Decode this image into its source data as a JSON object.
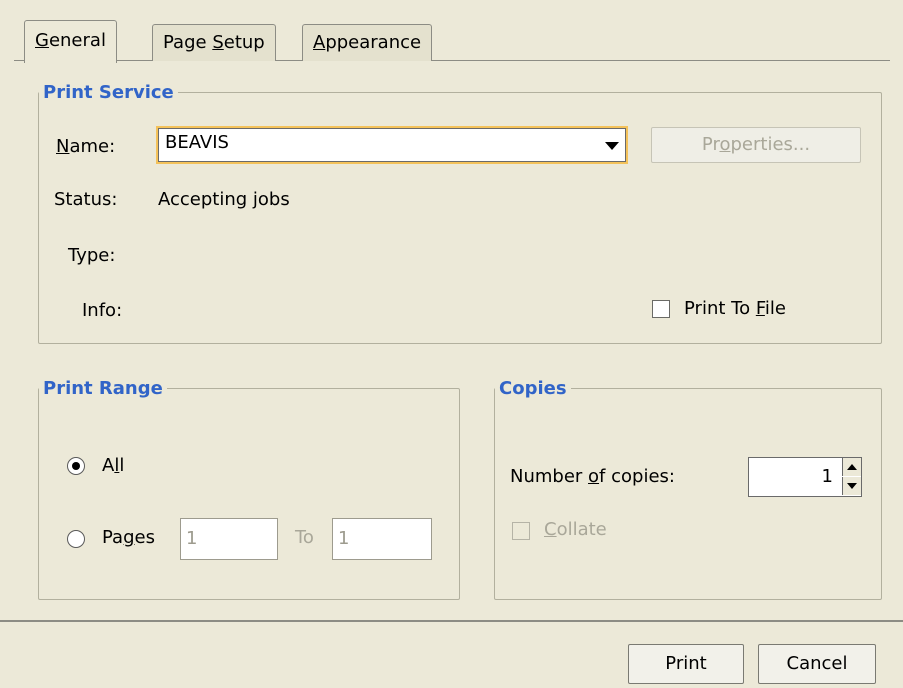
{
  "tabs": [
    {
      "label": "General",
      "mnemonic": "G",
      "rest": "eneral",
      "active": true
    },
    {
      "label": "Page Setup",
      "pre": "Page ",
      "mnemonic": "S",
      "rest": "etup"
    },
    {
      "label": "Appearance",
      "mnemonic": "A",
      "rest": "ppearance"
    }
  ],
  "print_service": {
    "legend": "Print Service",
    "name_label": {
      "mnemonic": "N",
      "rest": "ame:"
    },
    "name_value": "BEAVIS",
    "properties_button": {
      "pre": "Pr",
      "mnemonic": "o",
      "rest": "perties..."
    },
    "status_label": "Status:",
    "status_value": "Accepting jobs",
    "type_label": "Type:",
    "info_label": "Info:",
    "print_to_file": {
      "pre": "Print To ",
      "mnemonic": "F",
      "rest": "ile",
      "checked": false
    }
  },
  "print_range": {
    "legend": "Print Range",
    "all": {
      "pre": "A",
      "mnemonic": "l",
      "rest": "l",
      "selected": true
    },
    "pages": {
      "pre": "Pa",
      "mnemonic": "g",
      "rest": "es",
      "selected": false
    },
    "from_value": "1",
    "to_label": "To",
    "to_value": "1"
  },
  "copies": {
    "legend": "Copies",
    "number_label": {
      "pre": "Number ",
      "mnemonic": "o",
      "rest": "f copies:"
    },
    "number_value": "1",
    "collate": {
      "mnemonic": "C",
      "rest": "ollate",
      "checked": false
    }
  },
  "buttons": {
    "print": "Print",
    "cancel": "Cancel"
  },
  "colors": {
    "legend": "#3164c8",
    "background": "#ece9d8",
    "combo_focus": "#f4c25a"
  }
}
